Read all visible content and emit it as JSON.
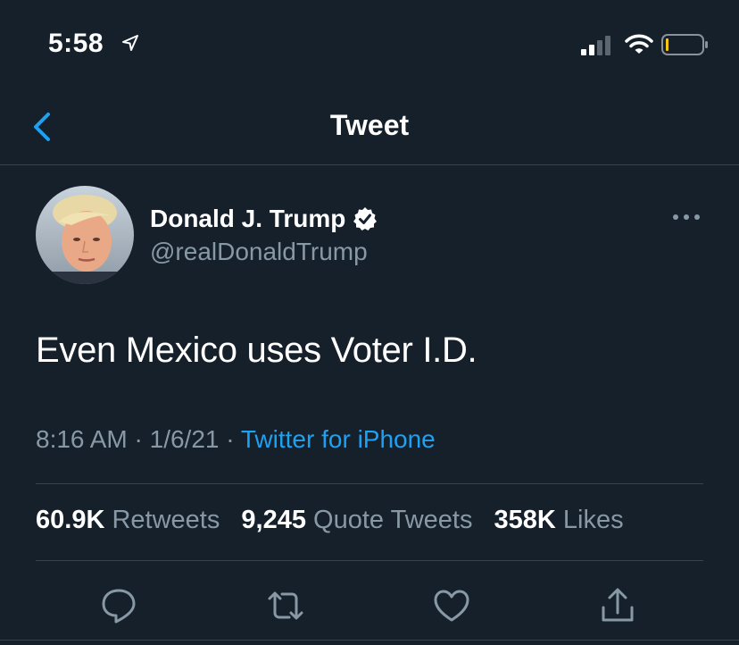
{
  "status_bar": {
    "time": "5:58",
    "icons": [
      "location-arrow-icon",
      "cellular-signal-icon",
      "wifi-icon",
      "battery-icon"
    ]
  },
  "nav": {
    "title": "Tweet",
    "back_icon": "chevron-left-icon"
  },
  "tweet": {
    "author": {
      "name": "Donald J. Trump",
      "handle": "@realDonaldTrump",
      "verified_icon": "verified-badge-icon"
    },
    "more_icon": "ellipsis-icon",
    "text": "Even Mexico uses Voter I.D.",
    "time": "8:16 AM",
    "separator": "·",
    "date": "1/6/21",
    "source": "Twitter for iPhone"
  },
  "stats": {
    "retweets_value": "60.9K",
    "retweets_label": "Retweets",
    "quote_value": "9,245",
    "quote_label": "Quote Tweets",
    "likes_value": "358K",
    "likes_label": "Likes"
  },
  "actions": {
    "icons": [
      "reply-icon",
      "retweet-icon",
      "like-icon",
      "share-icon"
    ]
  },
  "colors": {
    "background": "#15202b",
    "accent": "#1da1f2",
    "secondary_text": "#8899a6",
    "divider": "#38444d",
    "battery_level": "#f5c518"
  }
}
